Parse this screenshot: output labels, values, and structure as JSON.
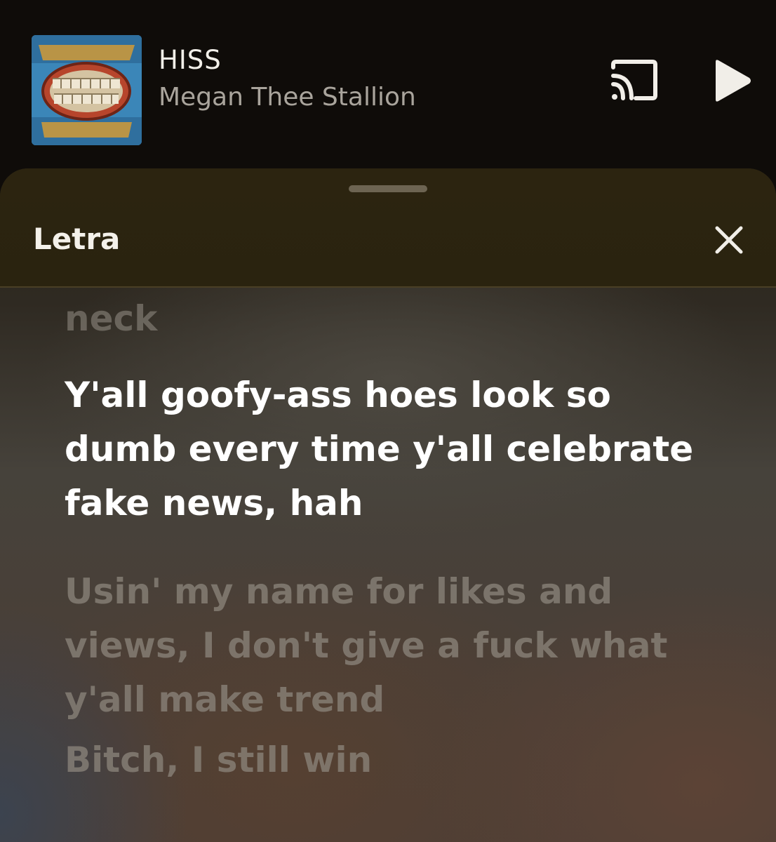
{
  "player": {
    "album_alt": "Megan Act II",
    "title": "HISS",
    "artist": "Megan Thee Stallion",
    "cast_icon": "cast-icon",
    "play_icon": "play-icon"
  },
  "lyrics_sheet": {
    "title": "Letra",
    "close_icon": "close-icon",
    "lines": {
      "previous": "neck",
      "current": "Y'all goofy-ass hoes look so dumb every time y'all celebrate fake news, hah",
      "next": "Usin' my name for likes and views, I don't give a fuck what y'all make trend",
      "after_next": "Bitch, I still win"
    }
  },
  "colors": {
    "background": "#0f0c09",
    "sheet_header": "#2c2410",
    "current_lyric": "#ffffff",
    "dim_lyric": "#8c867c",
    "artist_text": "#a9a49c"
  }
}
